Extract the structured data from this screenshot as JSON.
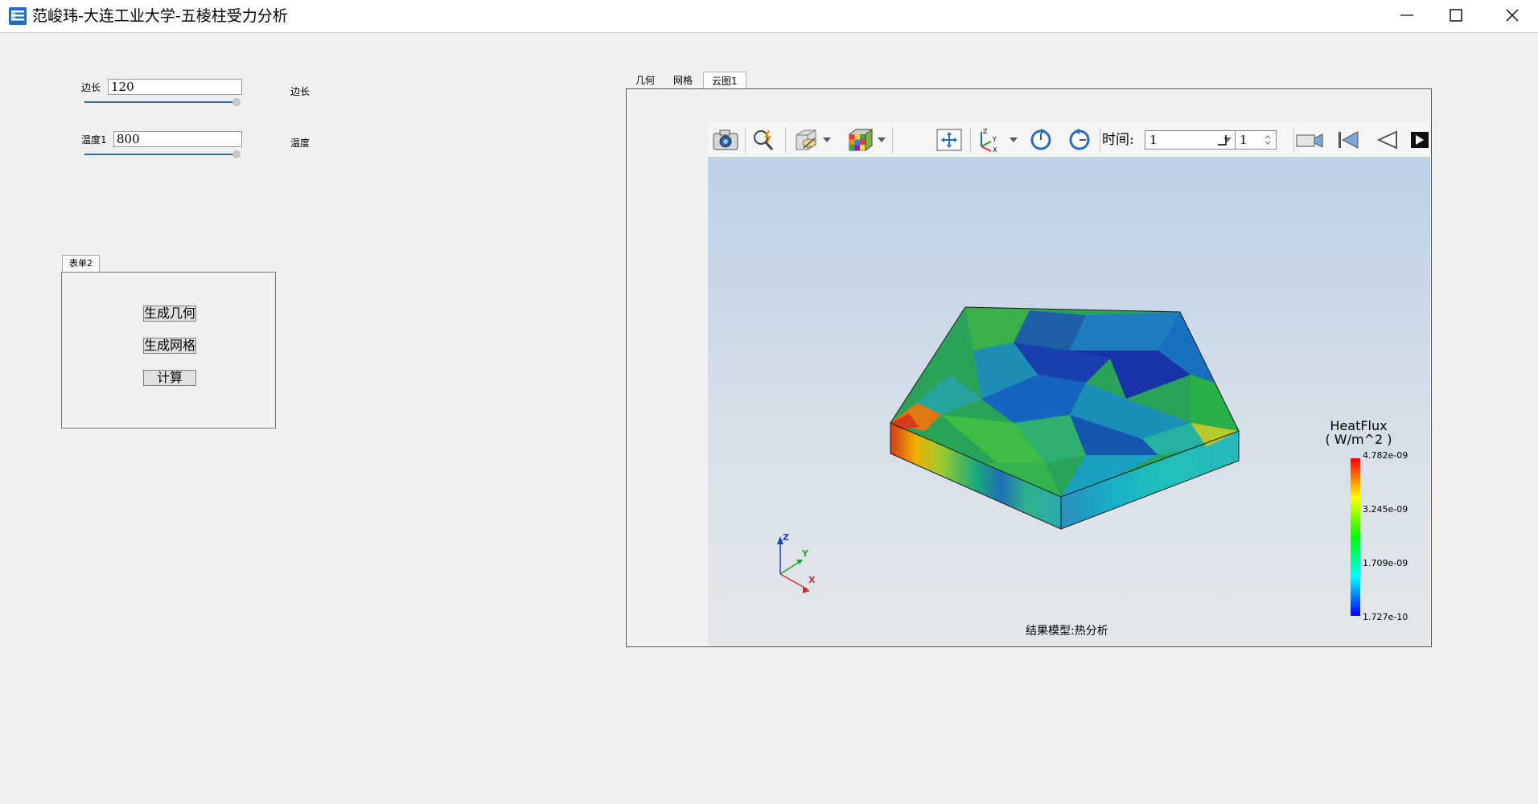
{
  "window": {
    "title": "范峻玮-大连工业大学-五棱柱受力分析",
    "icon": "app-icon",
    "controls": [
      "minimize-icon",
      "maximize-icon",
      "close-icon"
    ]
  },
  "params": {
    "side_label": "边长",
    "side_value": "120",
    "side_right_label": "边长",
    "temp_label": "温度1",
    "temp_value": "800",
    "temp_right_label": "温度"
  },
  "form2": {
    "tab_label": "表单2",
    "buttons": [
      "生成几何",
      "生成网格",
      "计算"
    ]
  },
  "tabs": [
    "几何",
    "网格",
    "云图1"
  ],
  "active_tab": "云图1",
  "toolbar": {
    "time_label": "时间:",
    "time_value": "1",
    "step_value": "1"
  },
  "legend": {
    "title_line1": "HeatFlux",
    "title_line2": "( W/m^2 )",
    "values": [
      "4.782e-09",
      "3.245e-09",
      "1.709e-09",
      "1.727e-10"
    ]
  },
  "axes": {
    "x": "X",
    "y": "Y",
    "z": "Z"
  },
  "caption": "结果模型:热分析",
  "colors": {
    "accent": "#2a6fb5",
    "viewport_top": "#bcd0e6",
    "viewport_bottom": "#e4e7ea"
  }
}
